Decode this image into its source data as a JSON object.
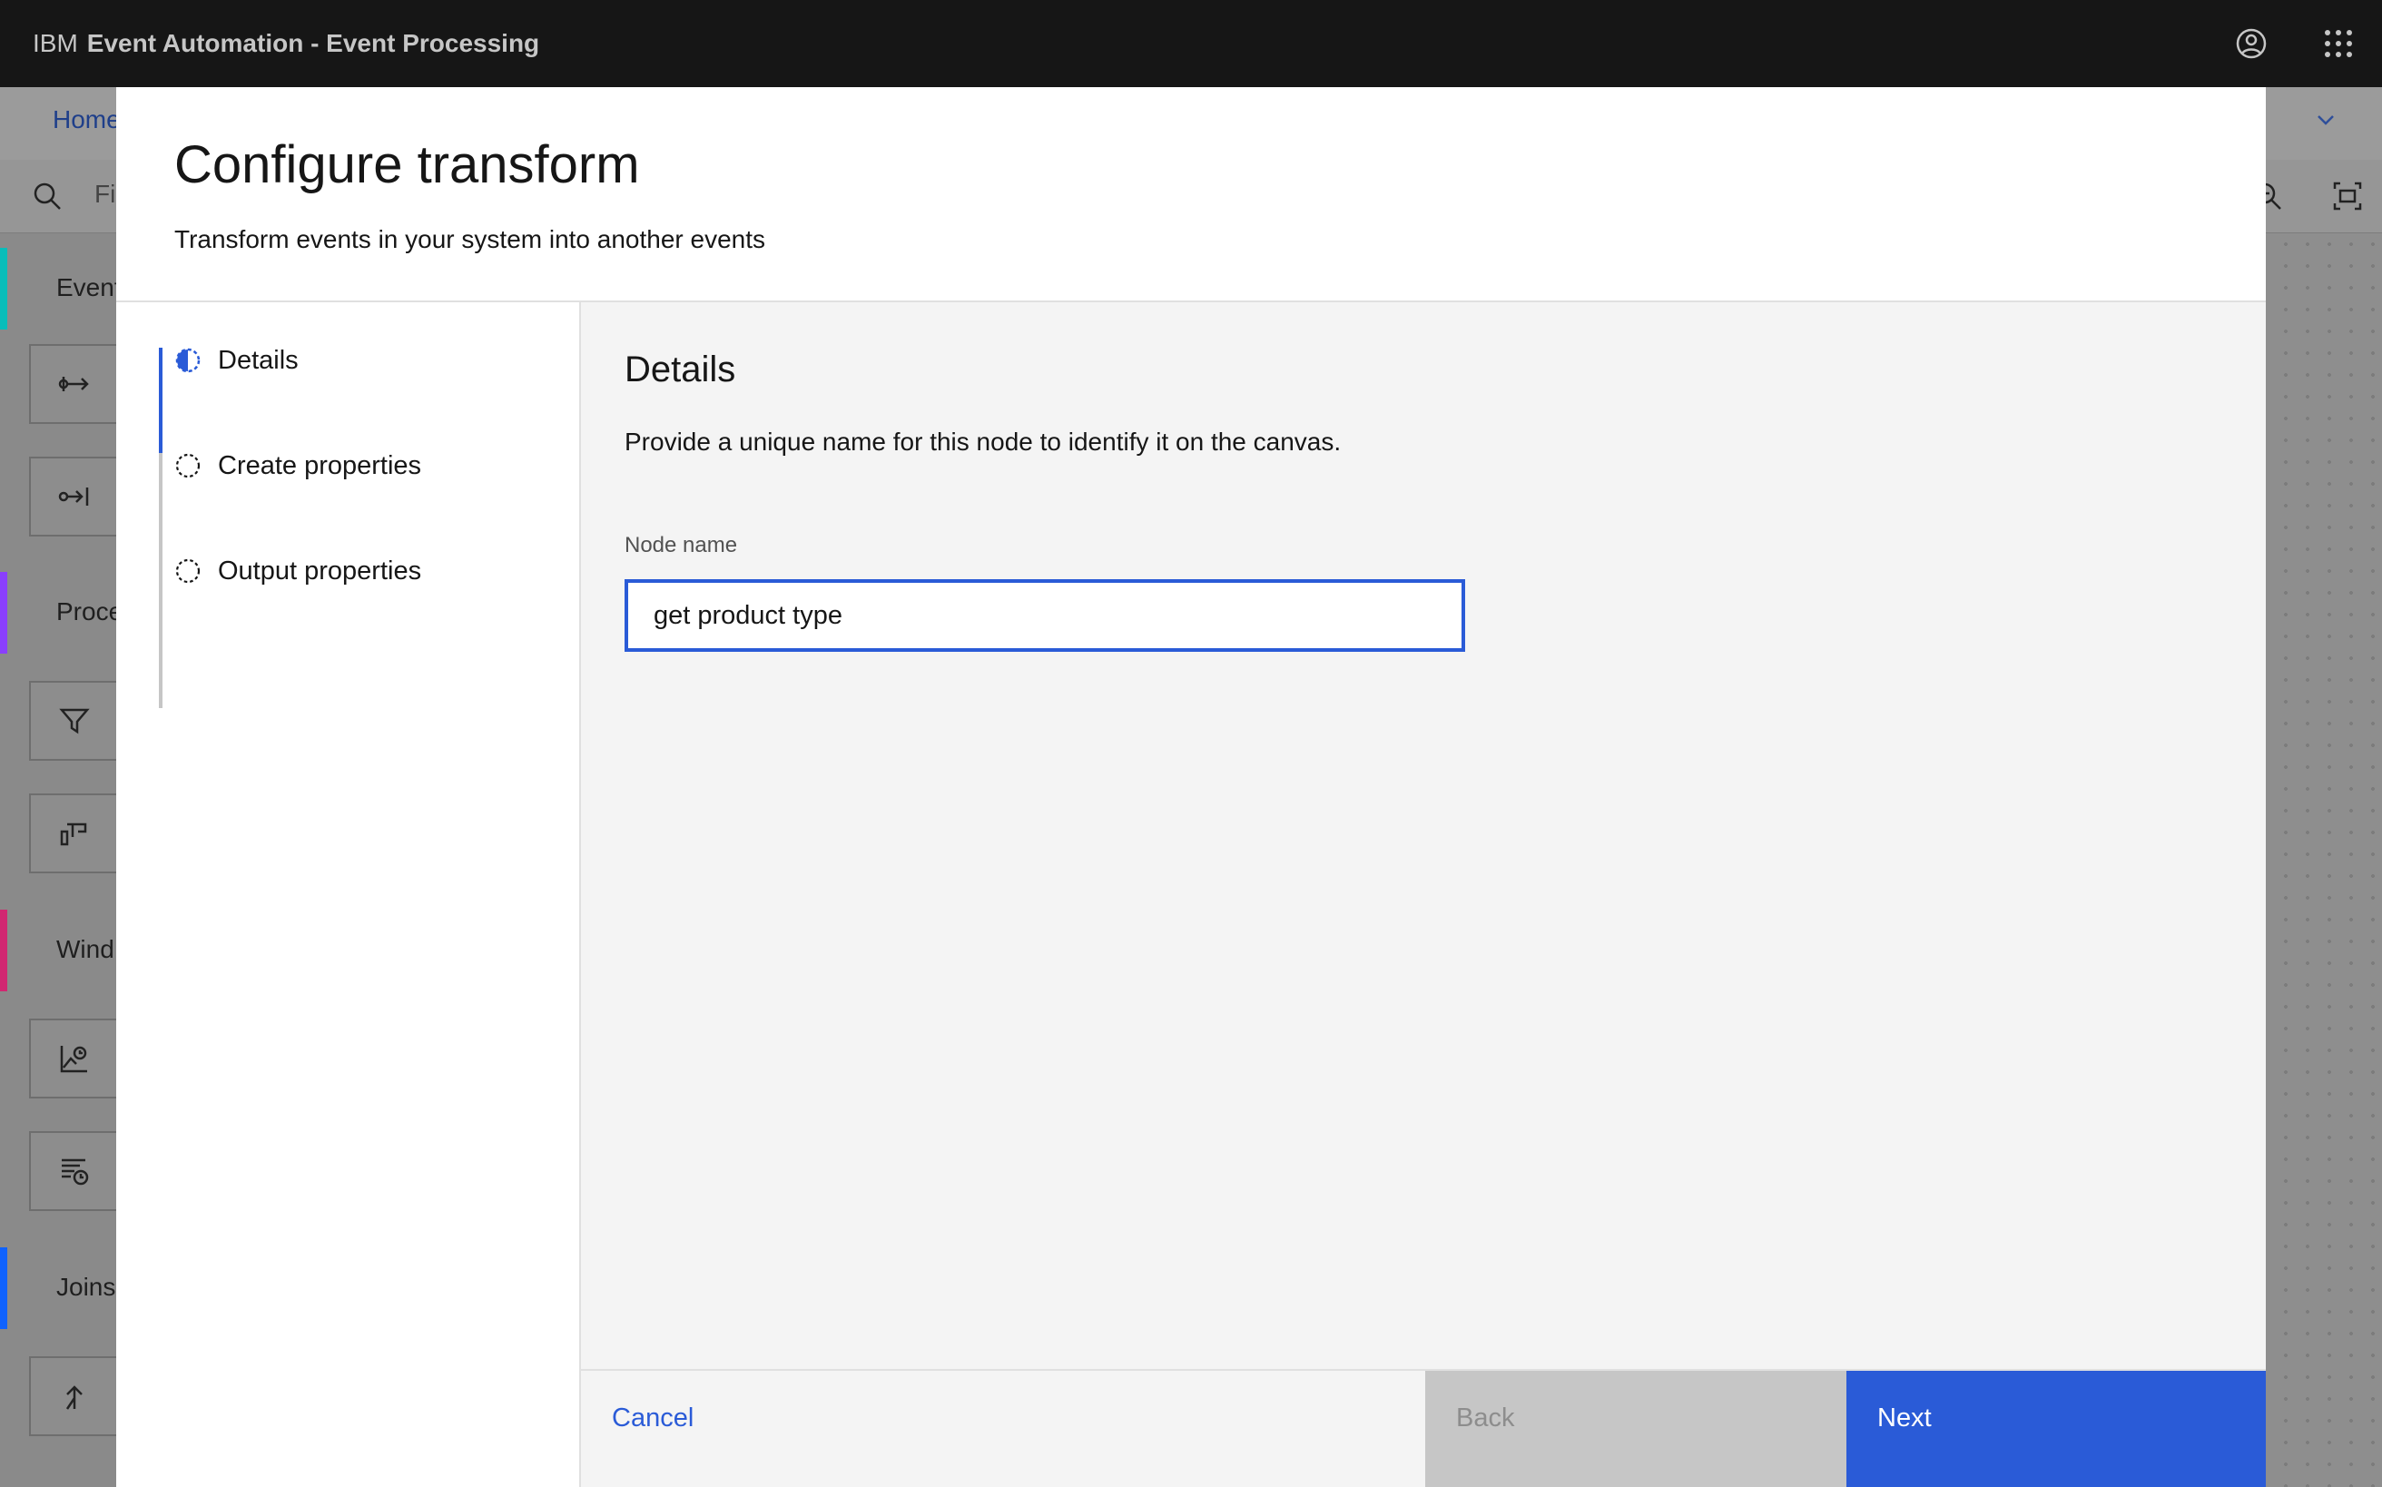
{
  "header": {
    "brand_prefix": "IBM",
    "brand_name": "Event Automation - Event Processing"
  },
  "background": {
    "tab_home": "Home",
    "filter_placeholder": "Fi",
    "categories": [
      {
        "label": "Event",
        "color": "#08bdba"
      },
      {
        "label": "Proce",
        "color": "#8a3ffc"
      },
      {
        "label": "Wind",
        "color": "#d12771"
      },
      {
        "label": "Joins",
        "color": "#0f62fe"
      }
    ]
  },
  "modal": {
    "title": "Configure transform",
    "subtitle": "Transform events in your system into another events",
    "steps": [
      {
        "label": "Details",
        "state": "current"
      },
      {
        "label": "Create properties",
        "state": "incomplete"
      },
      {
        "label": "Output properties",
        "state": "incomplete"
      }
    ],
    "details": {
      "title": "Details",
      "description": "Provide a unique name for this node to identify it on the canvas.",
      "node_name_label": "Node name",
      "node_name_value": "get product type"
    },
    "buttons": {
      "cancel": "Cancel",
      "back": "Back",
      "next": "Next"
    }
  },
  "colors": {
    "accent": "#2a5bd7",
    "header_bg": "#161616",
    "disabled_bg": "#c6c6c6"
  }
}
